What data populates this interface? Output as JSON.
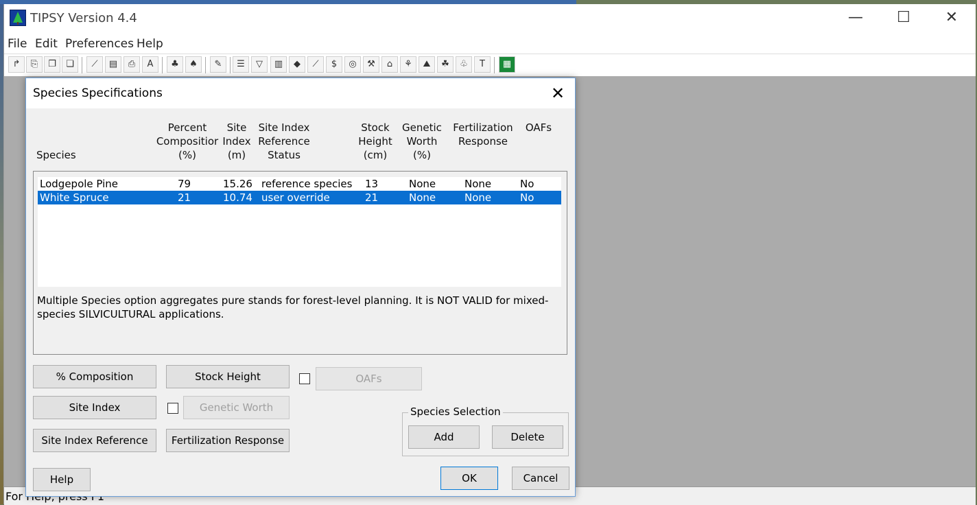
{
  "app": {
    "title": "TIPSY Version 4.4",
    "controls": {
      "minimize": "—",
      "maximize": "☐",
      "close": "✕"
    }
  },
  "menu": [
    "File",
    "Edit",
    "Preferences",
    "Help"
  ],
  "toolbar": {
    "icons": [
      "open-icon",
      "save-icon",
      "copy-icon",
      "paste-icon",
      "graph-icon",
      "table-icon",
      "print-icon",
      "font-icon",
      "tree-icon",
      "trees-icon",
      "pencil-icon",
      "list-icon",
      "filter-icon",
      "bar-chart-icon",
      "leaf-icon",
      "feather-icon",
      "dollar-icon",
      "dbm-icon",
      "harvest-icon",
      "stump-icon",
      "seedling-icon",
      "terrain-icon",
      "bush-icon",
      "forest-icon",
      "ts-icon",
      "map-icon"
    ]
  },
  "status_bar": {
    "text": "For Help, press F1"
  },
  "dialog": {
    "title": "Species Specifications",
    "close": "✕",
    "headers": {
      "species": "Species",
      "percent": [
        "Percent",
        "Compositior",
        "(%)"
      ],
      "site_index": [
        "Site",
        "Index",
        "(m)"
      ],
      "reference": [
        "Site Index",
        "Reference",
        "Status"
      ],
      "stock_height": [
        "Stock",
        "Height",
        "(cm)"
      ],
      "genetic_worth": [
        "Genetic",
        "Worth",
        "(%)"
      ],
      "fertilization": [
        "Fertilization",
        "Response"
      ],
      "oafs": "OAFs"
    },
    "rows": [
      {
        "species": "Lodgepole Pine",
        "percent": "79",
        "site_index": "15.26",
        "reference": "reference species",
        "stock_height": "13",
        "genetic_worth": "None",
        "fertilization": "None",
        "oafs": "No"
      },
      {
        "species": "White Spruce",
        "percent": "21",
        "site_index": "10.74",
        "reference": "user override",
        "stock_height": "21",
        "genetic_worth": "None",
        "fertilization": "None",
        "oafs": "No"
      }
    ],
    "selected_row": 1,
    "note": "Multiple Species option aggregates pure stands for forest-level planning.  It is NOT VALID for mixed-species SILVICULTURAL applications.",
    "buttons": {
      "composition": "% Composition",
      "stock_height": "Stock Height",
      "oafs": "OAFs",
      "site_index": "Site Index",
      "genetic_worth": "Genetic Worth",
      "site_index_reference": "Site Index Reference",
      "fertilization_response": "Fertilization Response",
      "help": "Help",
      "ok": "OK",
      "cancel": "Cancel"
    },
    "species_selection": {
      "label": "Species Selection",
      "add": "Add",
      "delete": "Delete"
    },
    "checkboxes": {
      "oafs_checked": false,
      "genetic_worth_checked": false
    }
  }
}
